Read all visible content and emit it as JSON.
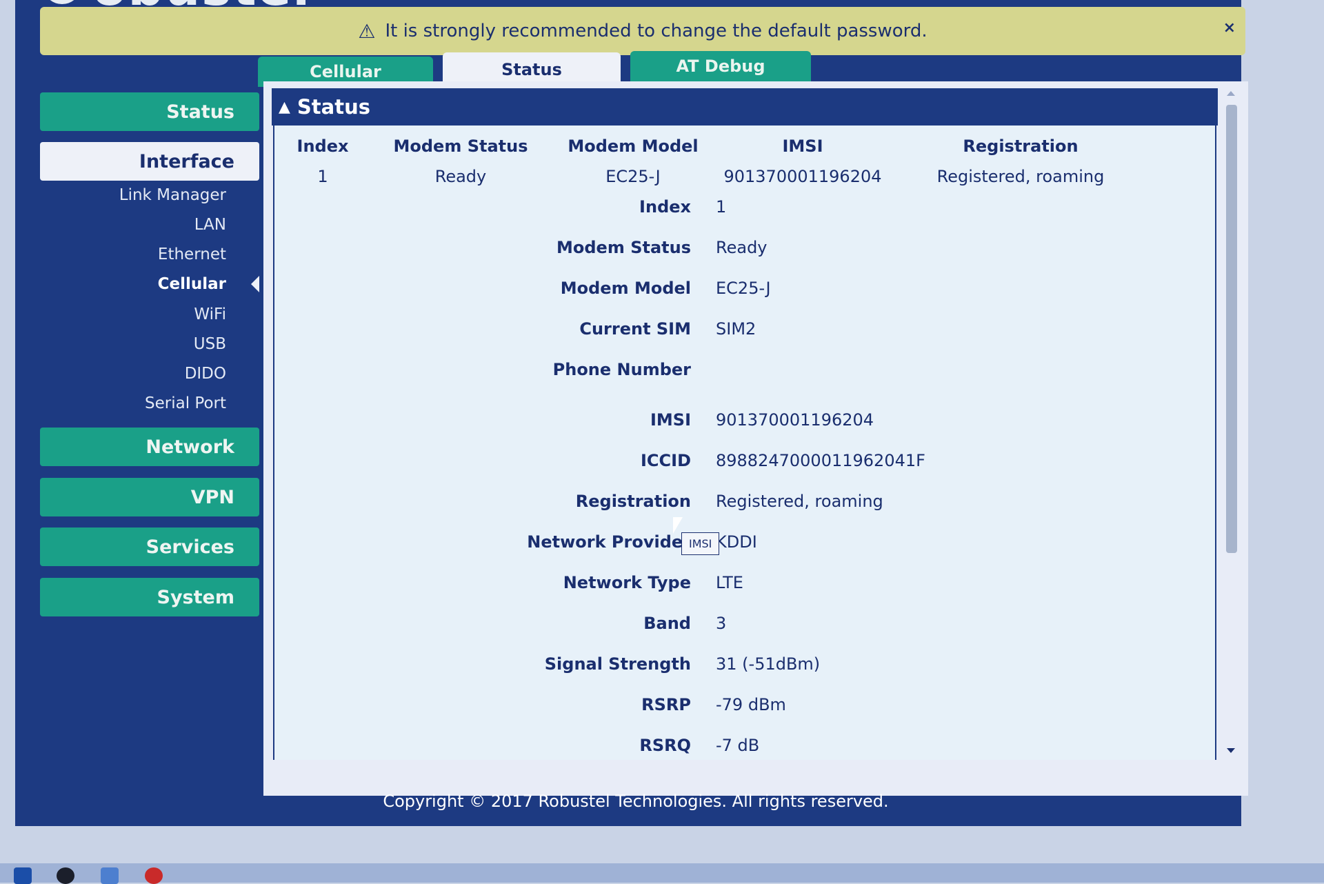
{
  "logo": {
    "text": "obustel"
  },
  "alert": {
    "message": "It is strongly recommended to change the default password.",
    "warn_icon": "⚠",
    "close_label": "×"
  },
  "tabs": [
    {
      "label": "Cellular"
    },
    {
      "label": "Status",
      "active": true
    },
    {
      "label": "AT Debug"
    }
  ],
  "sidebar": {
    "sections": [
      {
        "label": "Status"
      },
      {
        "label": "Interface",
        "active": true
      },
      {
        "label": "Network"
      },
      {
        "label": "VPN"
      },
      {
        "label": "Services"
      },
      {
        "label": "System"
      }
    ],
    "interface_items": [
      {
        "label": "Link Manager"
      },
      {
        "label": "LAN"
      },
      {
        "label": "Ethernet"
      },
      {
        "label": "Cellular",
        "selected": true
      },
      {
        "label": "WiFi"
      },
      {
        "label": "USB"
      },
      {
        "label": "DIDO"
      },
      {
        "label": "Serial Port"
      }
    ]
  },
  "panel": {
    "title": "Status",
    "table": {
      "headers": [
        "Index",
        "Modem Status",
        "Modem Model",
        "IMSI",
        "Registration"
      ],
      "rows": [
        [
          "1",
          "Ready",
          "EC25-J",
          "901370001196204",
          "Registered, roaming"
        ]
      ]
    },
    "details": [
      {
        "label": "Index",
        "value": "1"
      },
      {
        "label": "Modem Status",
        "value": "Ready"
      },
      {
        "label": "Modem Model",
        "value": "EC25-J"
      },
      {
        "label": "Current SIM",
        "value": "SIM2"
      },
      {
        "label": "Phone Number",
        "value": ""
      },
      {
        "label": "IMSI",
        "value": "901370001196204"
      },
      {
        "label": "ICCID",
        "value": "8988247000011962041F"
      },
      {
        "label": "Registration",
        "value": "Registered, roaming"
      },
      {
        "label": "Network Provider",
        "value": "KDDI"
      },
      {
        "label": "Network Type",
        "value": "LTE"
      },
      {
        "label": "Band",
        "value": "3"
      },
      {
        "label": "Signal Strength",
        "value": "31 (-51dBm)"
      },
      {
        "label": "RSRP",
        "value": "-79 dBm"
      },
      {
        "label": "RSRQ",
        "value": "-7 dB"
      }
    ],
    "tooltip": "IMSI"
  },
  "footer": {
    "text": "Copyright © 2017 Robustel Technologies. All rights reserved."
  },
  "colors": {
    "navy": "#1d3a82",
    "teal": "#1aa088",
    "alert": "#d5d68e",
    "panel": "#e7f1f9"
  }
}
